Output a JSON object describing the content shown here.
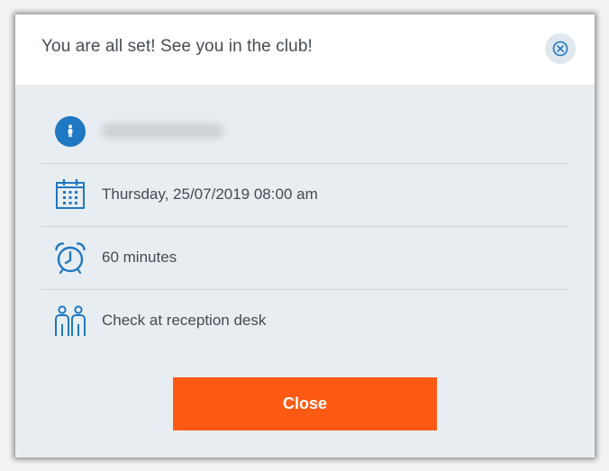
{
  "dialog": {
    "title": "You are all set! See you in the club!",
    "close_icon": "close-circle-icon"
  },
  "details": [
    {
      "icon": "person-icon",
      "text": ""
    },
    {
      "icon": "calendar-icon",
      "text": "Thursday, 25/07/2019 08:00 am"
    },
    {
      "icon": "alarm-clock-icon",
      "text": "60 minutes"
    },
    {
      "icon": "people-icon",
      "text": "Check at reception desk"
    }
  ],
  "actions": {
    "close_label": "Close"
  },
  "colors": {
    "accent": "#ff5a14",
    "icon_blue": "#1f78c2",
    "panel_bg": "#e8edf1"
  }
}
